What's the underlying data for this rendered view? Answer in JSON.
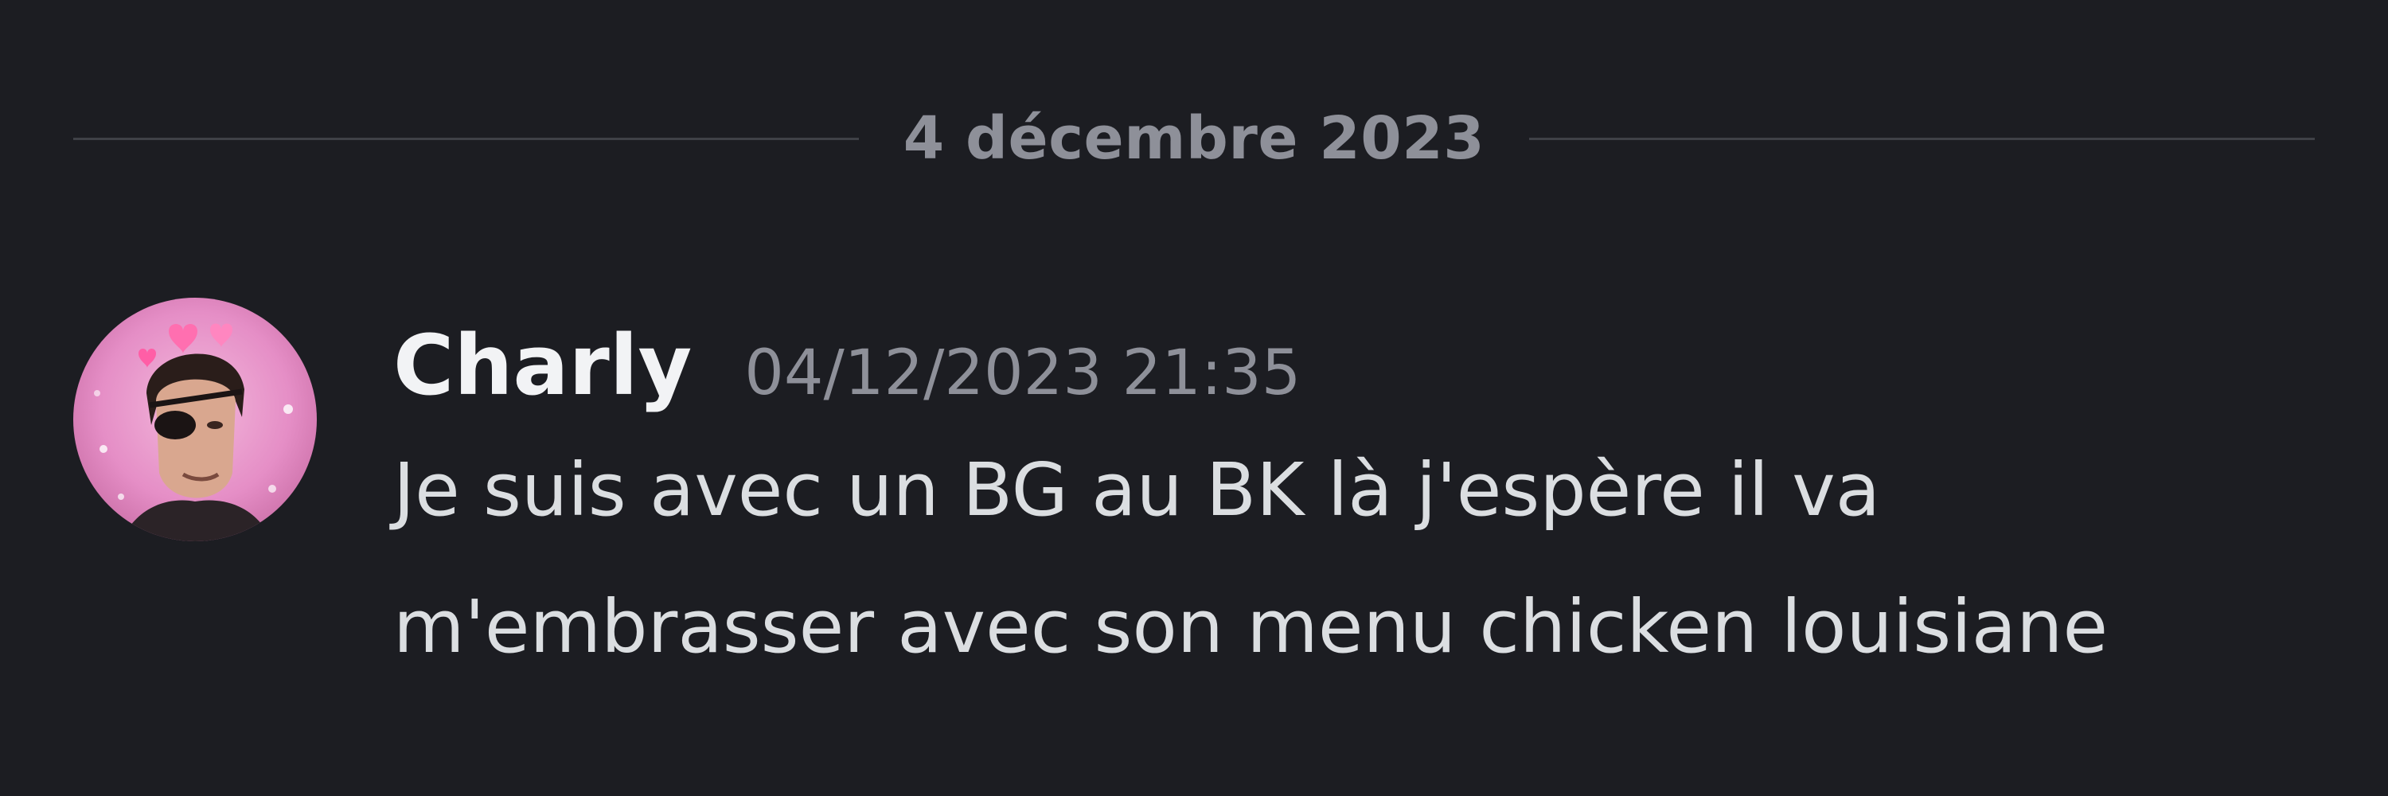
{
  "divider": {
    "date": "4 décembre 2023"
  },
  "message": {
    "author": "Charly",
    "timestamp": "04/12/2023 21:35",
    "lines": [
      "Je suis avec un BG au BK là j'espère il va",
      "m'embrasser avec son menu chicken louisiane"
    ]
  },
  "colors": {
    "background": "#1c1d22",
    "divider_line": "#3f4147",
    "muted_text": "#8e9099",
    "author_text": "#f2f3f5",
    "body_text": "#dbdee1",
    "avatar_pink": "#e58ec6"
  }
}
